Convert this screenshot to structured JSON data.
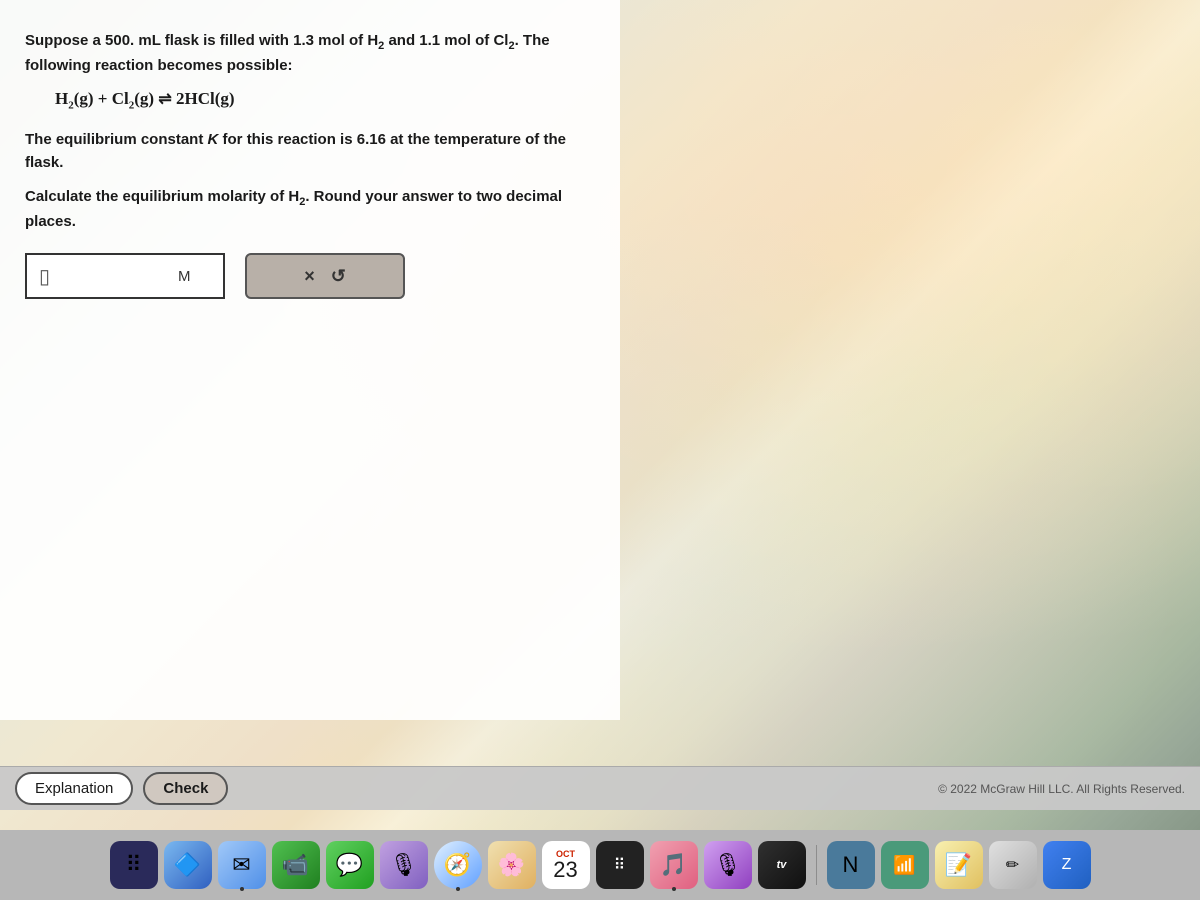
{
  "question": {
    "intro": "Suppose a 500. mL flask is filled with 1.3 mol of H₂ and 1.1 mol of Cl₂. The following reaction becomes possible:",
    "equation_text": "H₂(g) + Cl₂(g) ⇌ 2HCl(g)",
    "constant_text": "The equilibrium constant K for this reaction is 6.16 at the temperature of the flask.",
    "calculate_text": "Calculate the equilibrium molarity of H₂. Round your answer to two decimal places.",
    "unit": "M",
    "input_placeholder": ""
  },
  "buttons": {
    "explanation": "Explanation",
    "check": "Check",
    "x_symbol": "×",
    "undo_symbol": "↺"
  },
  "footer": {
    "copyright": "© 2022 McGraw Hill LLC. All Rights Reserved."
  },
  "dock": {
    "calendar_month": "OCT",
    "calendar_day": "23"
  }
}
